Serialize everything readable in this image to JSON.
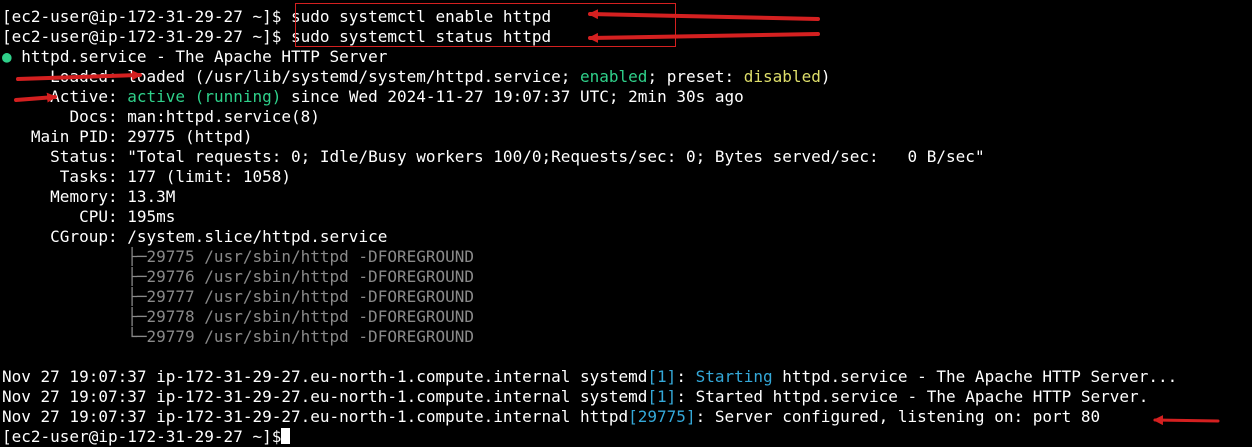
{
  "prompt": "[ec2-user@ip-172-31-29-27 ~]$",
  "commands": [
    "sudo systemctl enable httpd",
    "sudo systemctl status httpd"
  ],
  "status": {
    "service_line": "httpd.service - The Apache HTTP Server",
    "loaded_label": "Loaded:",
    "loaded_pre": "loaded (/usr/lib/systemd/system/httpd.service; ",
    "loaded_enabled": "enabled",
    "loaded_mid": "; preset: ",
    "loaded_preset": "disabled",
    "loaded_post": ")",
    "active_label": "Active:",
    "active_state": "active (running)",
    "active_since": "since Wed 2024-11-27 19:07:37 UTC; 2min 30s ago",
    "docs_label": "Docs:",
    "docs_value": "man:httpd.service(8)",
    "pid_label": "Main PID:",
    "pid_value": "29775 (httpd)",
    "st_label": "Status:",
    "st_value": "\"Total requests: 0; Idle/Busy workers 100/0;Requests/sec: 0; Bytes served/sec:   0 B/sec\"",
    "tasks_label": "Tasks:",
    "tasks_value": "177 (limit: 1058)",
    "memory_label": "Memory:",
    "memory_value": "13.3M",
    "cpu_label": "CPU:",
    "cpu_value": "195ms",
    "cgroup_label": "CGroup:",
    "cgroup_value": "/system.slice/httpd.service",
    "processes": [
      "├─29775 /usr/sbin/httpd -DFOREGROUND",
      "├─29776 /usr/sbin/httpd -DFOREGROUND",
      "├─29777 /usr/sbin/httpd -DFOREGROUND",
      "├─29778 /usr/sbin/httpd -DFOREGROUND",
      "└─29779 /usr/sbin/httpd -DFOREGROUND"
    ]
  },
  "log": [
    {
      "prefix": "Nov 27 19:07:37 ip-172-31-29-27.eu-north-1.compute.internal systemd",
      "pid": "[1]",
      "colon": ": ",
      "highlight": "Starting",
      "rest": " httpd.service - The Apache HTTP Server..."
    },
    {
      "prefix": "Nov 27 19:07:37 ip-172-31-29-27.eu-north-1.compute.internal systemd",
      "pid": "[1]",
      "colon": ": ",
      "highlight": "",
      "rest": "Started httpd.service - The Apache HTTP Server."
    },
    {
      "prefix": "Nov 27 19:07:37 ip-172-31-29-27.eu-north-1.compute.internal httpd",
      "pid": "[29775]",
      "colon": ": ",
      "highlight": "",
      "rest": "Server configured, listening on: port 80"
    }
  ],
  "colors": {
    "green": "#2fd08a",
    "yellow": "#dede6a",
    "cyan": "#34a8d8",
    "annotation_red": "#d42020"
  }
}
